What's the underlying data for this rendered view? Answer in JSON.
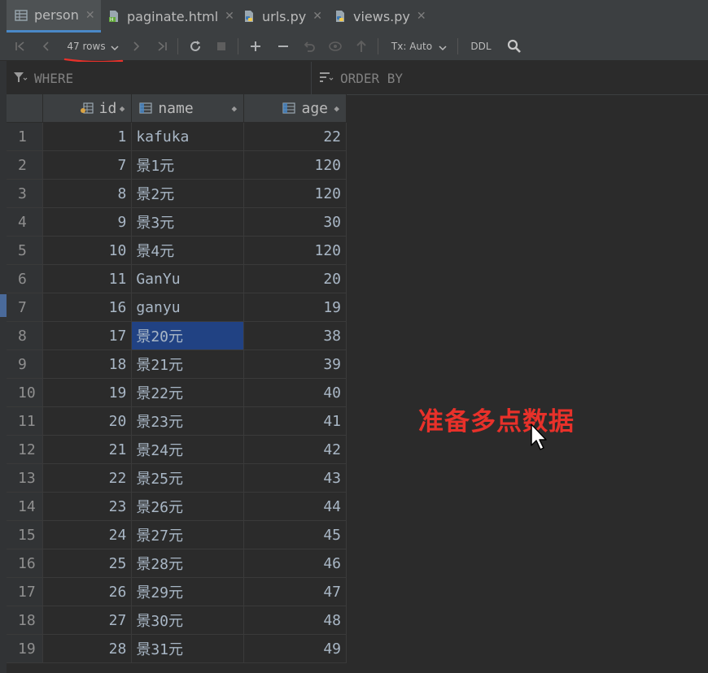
{
  "tabs": [
    {
      "label": "person",
      "icon": "table-icon",
      "active": true
    },
    {
      "label": "paginate.html",
      "icon": "html-file-icon",
      "active": false
    },
    {
      "label": "urls.py",
      "icon": "python-file-icon",
      "active": false
    },
    {
      "label": "views.py",
      "icon": "python-file-icon",
      "active": false
    }
  ],
  "toolbar": {
    "rows_label": "47 rows",
    "tx_label": "Tx: Auto",
    "ddl_label": "DDL"
  },
  "filter": {
    "where_label": "WHERE",
    "order_by_label": "ORDER BY"
  },
  "grid": {
    "columns": [
      "id",
      "name",
      "age"
    ],
    "rows": [
      {
        "rownum": "1",
        "id": "1",
        "name": "kafuka",
        "age": "22"
      },
      {
        "rownum": "2",
        "id": "7",
        "name": "景1元",
        "age": "120"
      },
      {
        "rownum": "3",
        "id": "8",
        "name": "景2元",
        "age": "120"
      },
      {
        "rownum": "4",
        "id": "9",
        "name": "景3元",
        "age": "30"
      },
      {
        "rownum": "5",
        "id": "10",
        "name": "景4元",
        "age": "120"
      },
      {
        "rownum": "6",
        "id": "11",
        "name": "GanYu",
        "age": "20"
      },
      {
        "rownum": "7",
        "id": "16",
        "name": "ganyu",
        "age": "19"
      },
      {
        "rownum": "8",
        "id": "17",
        "name": "景20元",
        "age": "38"
      },
      {
        "rownum": "9",
        "id": "18",
        "name": "景21元",
        "age": "39"
      },
      {
        "rownum": "10",
        "id": "19",
        "name": "景22元",
        "age": "40"
      },
      {
        "rownum": "11",
        "id": "20",
        "name": "景23元",
        "age": "41"
      },
      {
        "rownum": "12",
        "id": "21",
        "name": "景24元",
        "age": "42"
      },
      {
        "rownum": "13",
        "id": "22",
        "name": "景25元",
        "age": "43"
      },
      {
        "rownum": "14",
        "id": "23",
        "name": "景26元",
        "age": "44"
      },
      {
        "rownum": "15",
        "id": "24",
        "name": "景27元",
        "age": "45"
      },
      {
        "rownum": "16",
        "id": "25",
        "name": "景28元",
        "age": "46"
      },
      {
        "rownum": "17",
        "id": "26",
        "name": "景29元",
        "age": "47"
      },
      {
        "rownum": "18",
        "id": "27",
        "name": "景30元",
        "age": "48"
      },
      {
        "rownum": "19",
        "id": "28",
        "name": "景31元",
        "age": "49"
      }
    ],
    "selected_row": 8,
    "selected_column": "name"
  },
  "annotation": {
    "text": "准备多点数据",
    "color": "#e8312a"
  },
  "colors": {
    "background": "#2b2b2b",
    "selection": "#214283",
    "tab_underline": "#4a88c7"
  }
}
